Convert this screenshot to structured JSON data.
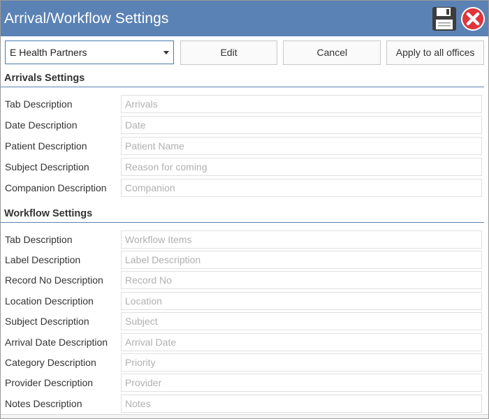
{
  "window": {
    "title": "Arrival/Workflow Settings"
  },
  "toolbar": {
    "office_selected": "E Health Partners",
    "edit_label": "Edit",
    "cancel_label": "Cancel",
    "apply_label": "Apply to all offices"
  },
  "arrivals": {
    "heading": "Arrivals Settings",
    "rows": [
      {
        "label": "Tab Description",
        "value": "Arrivals"
      },
      {
        "label": "Date Description",
        "value": "Date"
      },
      {
        "label": "Patient Description",
        "value": "Patient Name"
      },
      {
        "label": "Subject Description",
        "value": "Reason for coming"
      },
      {
        "label": "Companion Description",
        "value": "Companion"
      }
    ]
  },
  "workflow": {
    "heading": "Workflow Settings",
    "rows": [
      {
        "label": "Tab Description",
        "value": "Workflow Items"
      },
      {
        "label": "Label Description",
        "value": "Label Description"
      },
      {
        "label": "Record No Description",
        "value": "Record No"
      },
      {
        "label": "Location Description",
        "value": "Location"
      },
      {
        "label": "Subject Description",
        "value": "Subject"
      },
      {
        "label": "Arrival Date Description",
        "value": "Arrival Date"
      },
      {
        "label": "Category Description",
        "value": "Priority"
      },
      {
        "label": "Provider Description",
        "value": "Provider"
      },
      {
        "label": "Notes Description",
        "value": "Notes"
      }
    ]
  },
  "icons": {
    "save": "save-icon",
    "close": "close-icon",
    "dropdown": "chevron-down-icon"
  },
  "colors": {
    "titlebar": "#5b82b4",
    "accent_border": "#4a7aae",
    "close_red": "#e0343a"
  }
}
